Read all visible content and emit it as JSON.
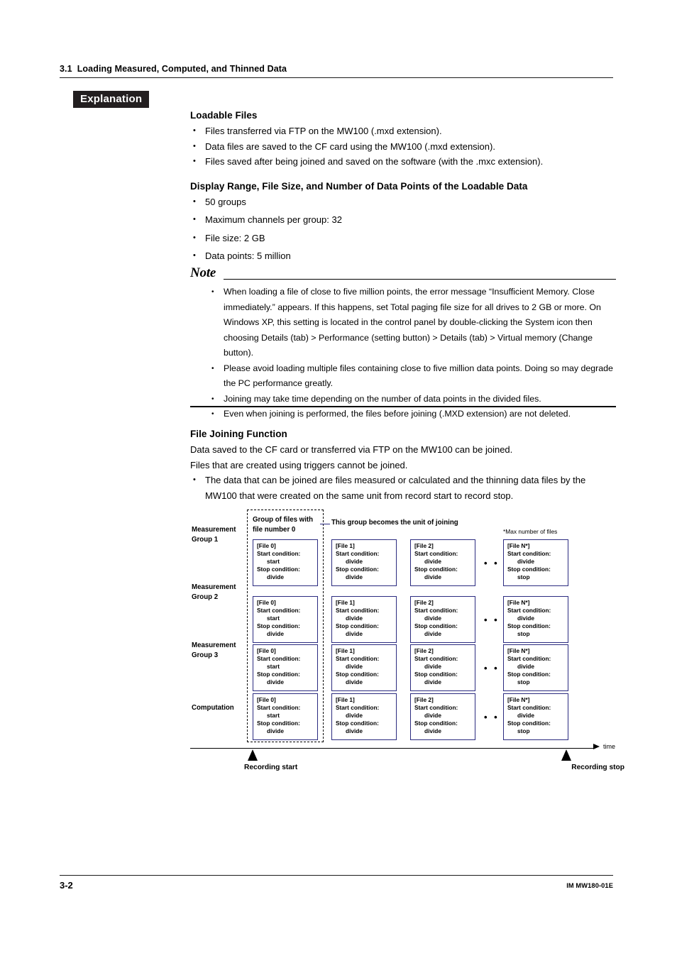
{
  "running_head": {
    "number": "3.1",
    "title": "Loading Measured, Computed, and Thinned Data"
  },
  "explanation_tag": "Explanation",
  "sections": {
    "loadable_files": {
      "heading": "Loadable Files",
      "bullets": [
        "Files transferred via FTP on the MW100 (.mxd extension).",
        "Data files are saved to the CF card using the MW100 (.mxd extension).",
        "Files saved after being joined and saved on the software (with the .mxc extension)."
      ]
    },
    "display_range": {
      "heading": "Display Range, File Size, and Number of Data Points of the Loadable Data",
      "bullets": [
        "50 groups",
        "Maximum channels per group: 32",
        "File size: 2 GB",
        "Data points: 5 million"
      ]
    },
    "note": {
      "heading": "Note",
      "bullets": [
        "When loading a file of close to five million points, the error message “Insufficient Memory. Close immediately.” appears. If this happens, set Total paging file size for all drives to 2 GB or more. On Windows XP, this setting is located in the control panel by double-clicking the System icon then choosing Details (tab) > Performance (setting button) > Details (tab) > Virtual memory (Change button).",
        "Please avoid loading multiple files containing close to five million data points. Doing so may degrade the PC performance greatly.",
        "Joining may take time depending on the number of data points in the divided files.",
        "Even when joining is performed, the files before joining (.MXD extension) are not deleted."
      ]
    },
    "file_joining": {
      "heading": "File Joining Function",
      "paragraphs": [
        "Data saved to the CF card or transferred via FTP on the MW100 can be joined.",
        "Files that are created using triggers cannot be joined."
      ],
      "bullets": [
        "The data that can be joined are files measured or calculated and the thinning data files by the MW100 that were created on the same unit from record start to record stop."
      ]
    }
  },
  "diagram": {
    "group_label": "Group of files with file number 0",
    "unit_label": "This group becomes the unit of joining",
    "max_files_note": "*Max number of files",
    "ellipsis": "• • •",
    "box_border_color": "#2b2b80",
    "row_labels": [
      "Measurement Group 1",
      "Measurement Group 2",
      "Measurement Group 3",
      "Computation"
    ],
    "column_files": [
      {
        "title": "[File 0]",
        "start_label": "Start condition:",
        "start_value": "start",
        "stop_label": "Stop condition:",
        "stop_value": "divide"
      },
      {
        "title": "[File 1]",
        "start_label": "Start condition:",
        "start_value": "divide",
        "stop_label": "Stop condition:",
        "stop_value": "divide"
      },
      {
        "title": "[File 2]",
        "start_label": "Start condition:",
        "start_value": "divide",
        "stop_label": "Stop condition:",
        "stop_value": "divide"
      },
      {
        "title": "[File N*]",
        "start_label": "Start condition:",
        "start_value": "divide",
        "stop_label": "Stop condition:",
        "stop_value": "stop"
      }
    ],
    "timeline": {
      "axis_label": "time",
      "start_marker": "Recording start",
      "stop_marker": "Recording stop"
    }
  },
  "footer": {
    "page_number": "3-2",
    "document_code": "IM MW180-01E"
  }
}
